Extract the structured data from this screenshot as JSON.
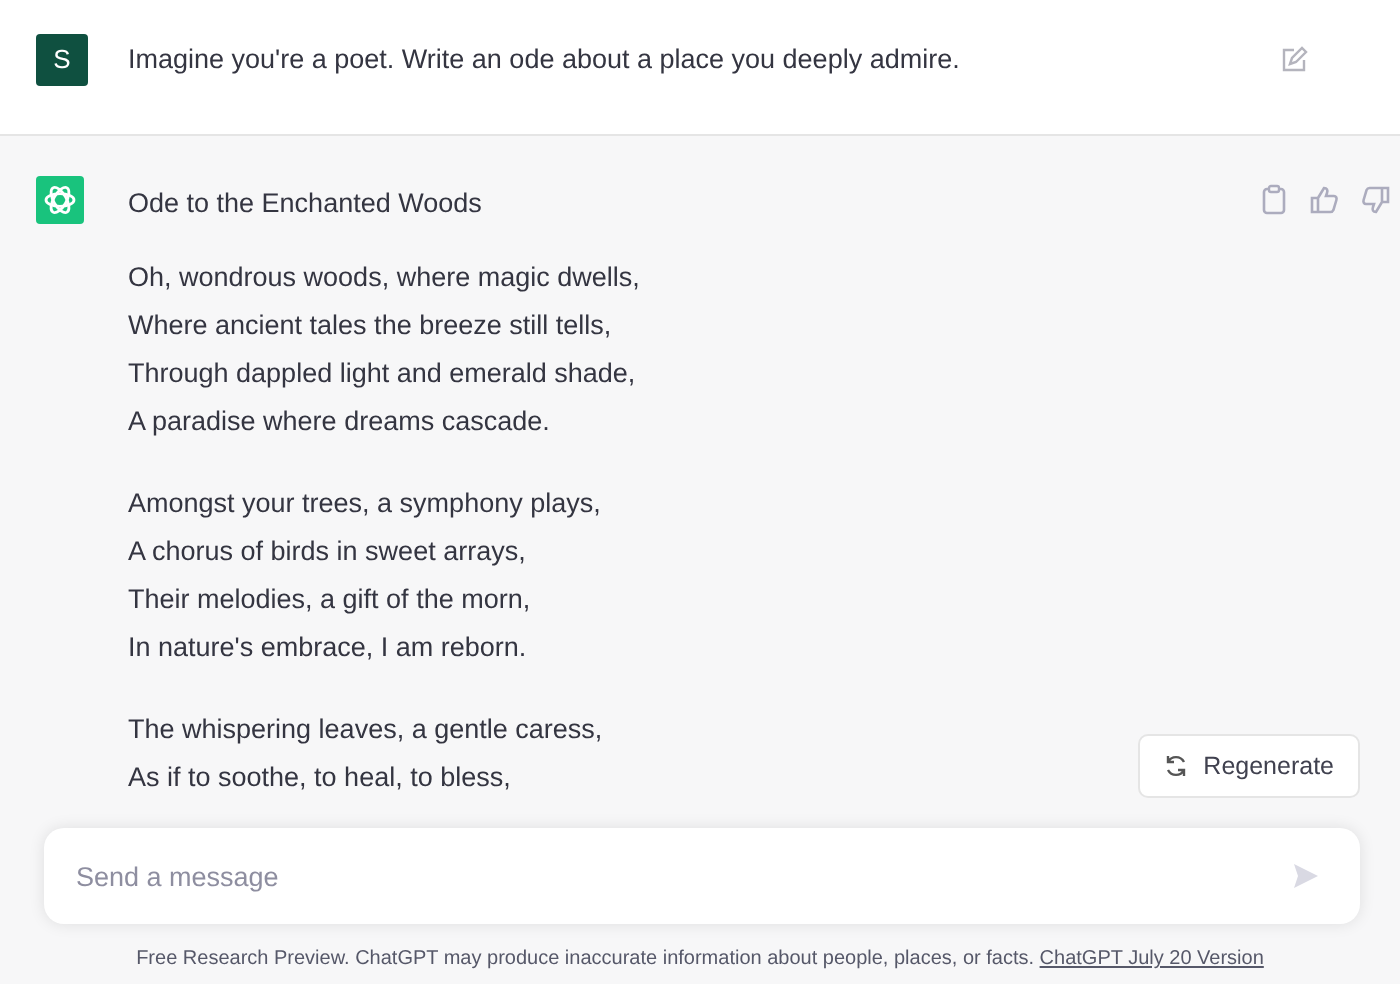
{
  "user_message": {
    "avatar": "S",
    "text": "Imagine you're a poet. Write an ode about a place you deeply admire."
  },
  "reply": {
    "title": "Ode to the Enchanted Woods",
    "stanzas": [
      [
        "Oh, wondrous woods, where magic dwells,",
        "Where ancient tales the breeze still tells,",
        "Through dappled light and emerald shade,",
        "A paradise where dreams cascade."
      ],
      [
        "Amongst your trees, a symphony plays,",
        "A chorus of birds in sweet arrays,",
        "Their melodies, a gift of the morn,",
        "In nature's embrace, I am reborn."
      ],
      [
        "The whispering leaves, a gentle caress,",
        "As if to soothe, to heal, to bless,"
      ]
    ]
  },
  "regenerate_button": "Regenerate",
  "composer": {
    "placeholder": "Send a message"
  },
  "footer": {
    "text": "Free Research Preview. ChatGPT may produce inaccurate information about people, places, or facts.",
    "link": "ChatGPT July 20 Version"
  }
}
